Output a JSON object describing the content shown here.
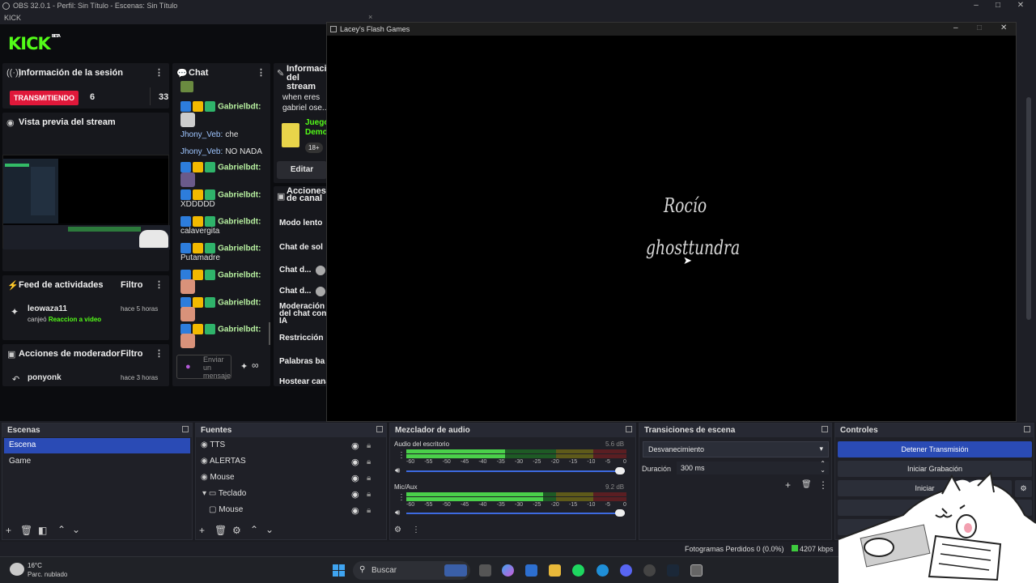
{
  "window": {
    "title": "OBS 32.0.1 - Perfil: Sin Título - Escenas: Sin Título",
    "dock_label": "KICK"
  },
  "kick": {
    "logo": "KICK",
    "logo_badge": "BETA",
    "session": {
      "title": "Información de la sesión",
      "status": "TRANSMITIENDO",
      "viewers": "6",
      "followers": "33"
    },
    "preview": {
      "title": "Vista previa del stream"
    },
    "activity": {
      "title": "Feed de actividades",
      "filter": "Filtro",
      "user": "leowaza11",
      "action_prefix": "canjeó",
      "action": "Reaccion a video",
      "time": "hace 5 horas"
    },
    "moderator": {
      "title": "Acciones de moderador",
      "filter": "Filtro",
      "user": "ponyonk",
      "time": "hace 3 horas"
    },
    "chat": {
      "title": "Chat",
      "messages": [
        {
          "user": "Gabrielbdt:",
          "text": ""
        },
        {
          "user": "Jhony_Veb:",
          "text": "che"
        },
        {
          "user": "Jhony_Veb:",
          "text": "NO NADA"
        },
        {
          "user": "Gabrielbdt:",
          "text": ""
        },
        {
          "user": "Gabrielbdt:",
          "text": "XDDDDD"
        },
        {
          "user": "Gabrielbdt:",
          "text": "calavergita"
        },
        {
          "user": "Gabrielbdt:",
          "text": "Putamadre"
        },
        {
          "user": "Gabrielbdt:",
          "text": ""
        },
        {
          "user": "Gabrielbdt:",
          "text": ""
        },
        {
          "user": "Gabrielbdt:",
          "text": ""
        }
      ],
      "input_placeholder": "Enviar un mensaje"
    },
    "stream_info": {
      "title": "Información del stream",
      "stream_title": "when eres gabriel ose...",
      "category": "Juego Demo",
      "age": "18+",
      "edit": "Editar"
    },
    "channel_actions": {
      "title": "Acciones de canal",
      "items": [
        "Modo lento",
        "Chat de sol",
        "Chat d...",
        "Chat d...",
        "Moderación del chat con IA",
        "Restricción",
        "Palabras ba",
        "Hostear cana"
      ]
    }
  },
  "game": {
    "title": "Lacey's Flash Games",
    "credits": [
      "Rocío",
      "ghosttundra"
    ]
  },
  "docks": {
    "scenes": {
      "title": "Escenas",
      "items": [
        "Escena",
        "Game"
      ],
      "selected": 0
    },
    "sources": {
      "title": "Fuentes",
      "items": [
        "TTS",
        "ALERTAS",
        "Mouse",
        "Teclado",
        "Mouse"
      ]
    },
    "mixer": {
      "title": "Mezclador de audio",
      "channels": [
        {
          "name": "Audio del escritorio",
          "db": "5.6 dB",
          "level": 0.45
        },
        {
          "name": "Mic/Aux",
          "db": "9.2 dB",
          "level": 0.62
        }
      ],
      "scale": [
        "-60",
        "-55",
        "-50",
        "-45",
        "-40",
        "-35",
        "-30",
        "-25",
        "-20",
        "-15",
        "-10",
        "-5",
        "0"
      ]
    },
    "transitions": {
      "title": "Transiciones de escena",
      "selected": "Desvanecimiento",
      "duration_label": "Duración",
      "duration": "300 ms"
    },
    "controls": {
      "title": "Controles",
      "stop_stream": "Detener Transmisión",
      "start_record": "Iniciar Grabación",
      "start_virtual": "Iniciar"
    }
  },
  "status": {
    "dropped": "Fotogramas Perdidos 0 (0.0%)",
    "bitrate": "4207 kbps"
  },
  "taskbar": {
    "temp": "16°C",
    "weather": "Parc. nublado",
    "search": "Buscar"
  },
  "colors": {
    "accent": "#2a4bb5",
    "kick_green": "#53fc18",
    "live_red": "#e0183a"
  }
}
